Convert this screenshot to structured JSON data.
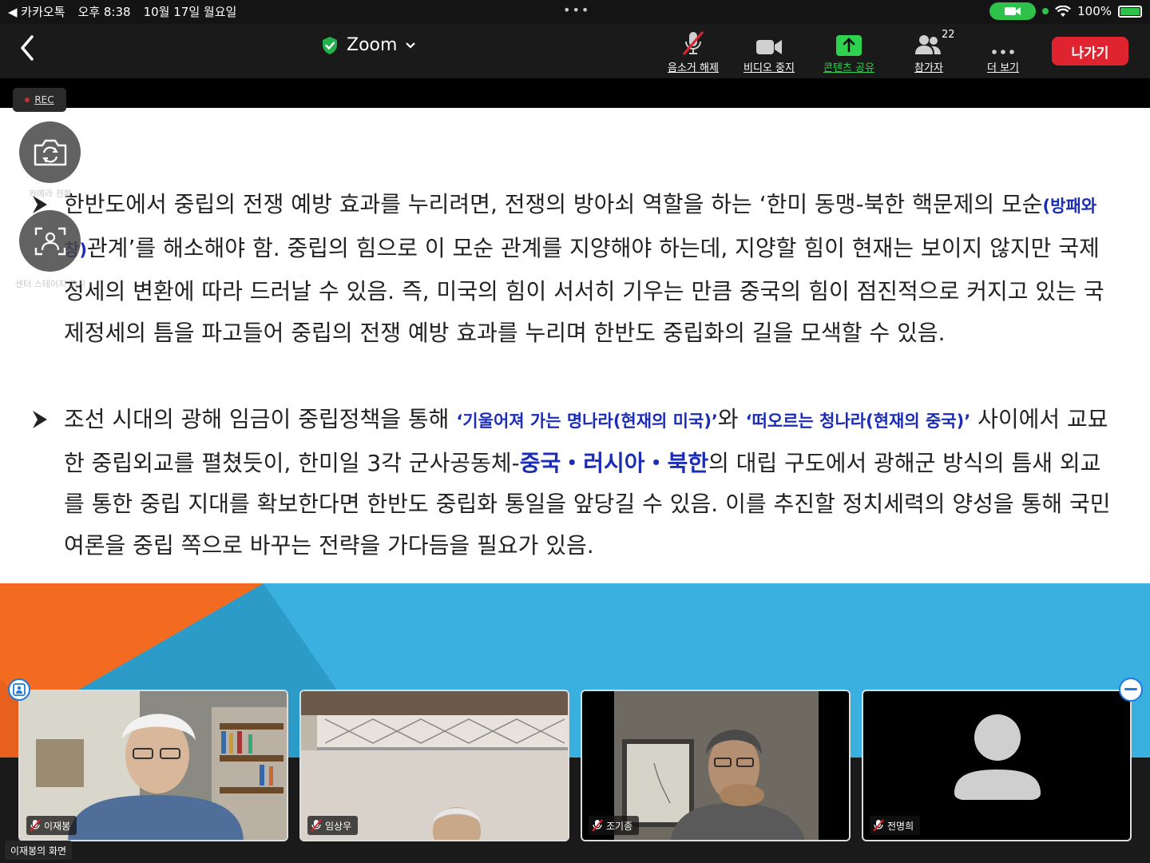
{
  "status_bar": {
    "back_app": "◀ 카카오톡",
    "time": "오후 8:38",
    "date": "10월 17일 월요일",
    "battery": "100%"
  },
  "toolbar": {
    "title": "Zoom",
    "unmute": "음소거 해제",
    "stop_video": "비디오 중지",
    "share_content": "콘텐츠 공유",
    "participants": "참가자",
    "participant_count": "22",
    "more": "더 보기",
    "leave": "나가기",
    "rec": "REC"
  },
  "side_buttons": {
    "switch_camera": "카메라 전환",
    "center_stage": "센터 스테이지 끄기"
  },
  "slide": {
    "bullet1": {
      "p1": "한반도에서 중립의 전쟁 예방 효과를 누리려면, 전쟁의 방아쇠 역할을 하는 ‘한미 동맹-북한 핵문제의 모순",
      "p2": "(방패와 창)",
      "p3": "관계’를 해소해야 함. 중립의 힘으로 이 모순 관계를 지양해야 하는데, 지양할 힘이 현재는 보이지 않지만 국제정세의 변환에 따라 드러날 수 있음. 즉, 미국의 힘이 서서히 기우는 만큼 중국의 힘이 점진적으로 커지고 있는 국제정세의 틈을 파고들어 중립의 전쟁 예방 효과를 누리며 한반도 중립화의 길을 모색할 수 있음."
    },
    "bullet2": {
      "p1": "조선 시대의 광해 임금이 중립정책을 통해 ",
      "p2": "‘기울어져 가는 명나라",
      "p3": "(현재의 미국)",
      "p4": "’",
      "p5": "와 ",
      "p6": "‘떠오르는 청나라",
      "p7": "(현재의 중국)",
      "p8": "’",
      "p9": " 사이에서 교묘한 중립외교를 펼쳤듯이, 한미일 3각 군사공동체-",
      "p10": "중국・러시아・북한",
      "p11": "의 대립 구도에서 광해군 방식의 틈새 외교를 통한 중립 지대를 확보한다면 한반도 중립화 통일을 앞당길 수 있음. 이를 추진할 정치세력의 양성을 통해 국민 여론을 중립 쪽으로 바꾸는 전략을 가다듬을 필요가 있음."
    }
  },
  "participants": [
    {
      "name": "이재봉"
    },
    {
      "name": "임상우"
    },
    {
      "name": "조기종"
    },
    {
      "name": "전명희"
    }
  ],
  "screen_label": "이재봉의 화면",
  "colors": {
    "leave_red": "#e0242f",
    "share_green": "#2fd24f",
    "slide_blue": "#1b2cb5",
    "banner_blue": "#39b0e0",
    "banner_orange": "#f26b21"
  }
}
